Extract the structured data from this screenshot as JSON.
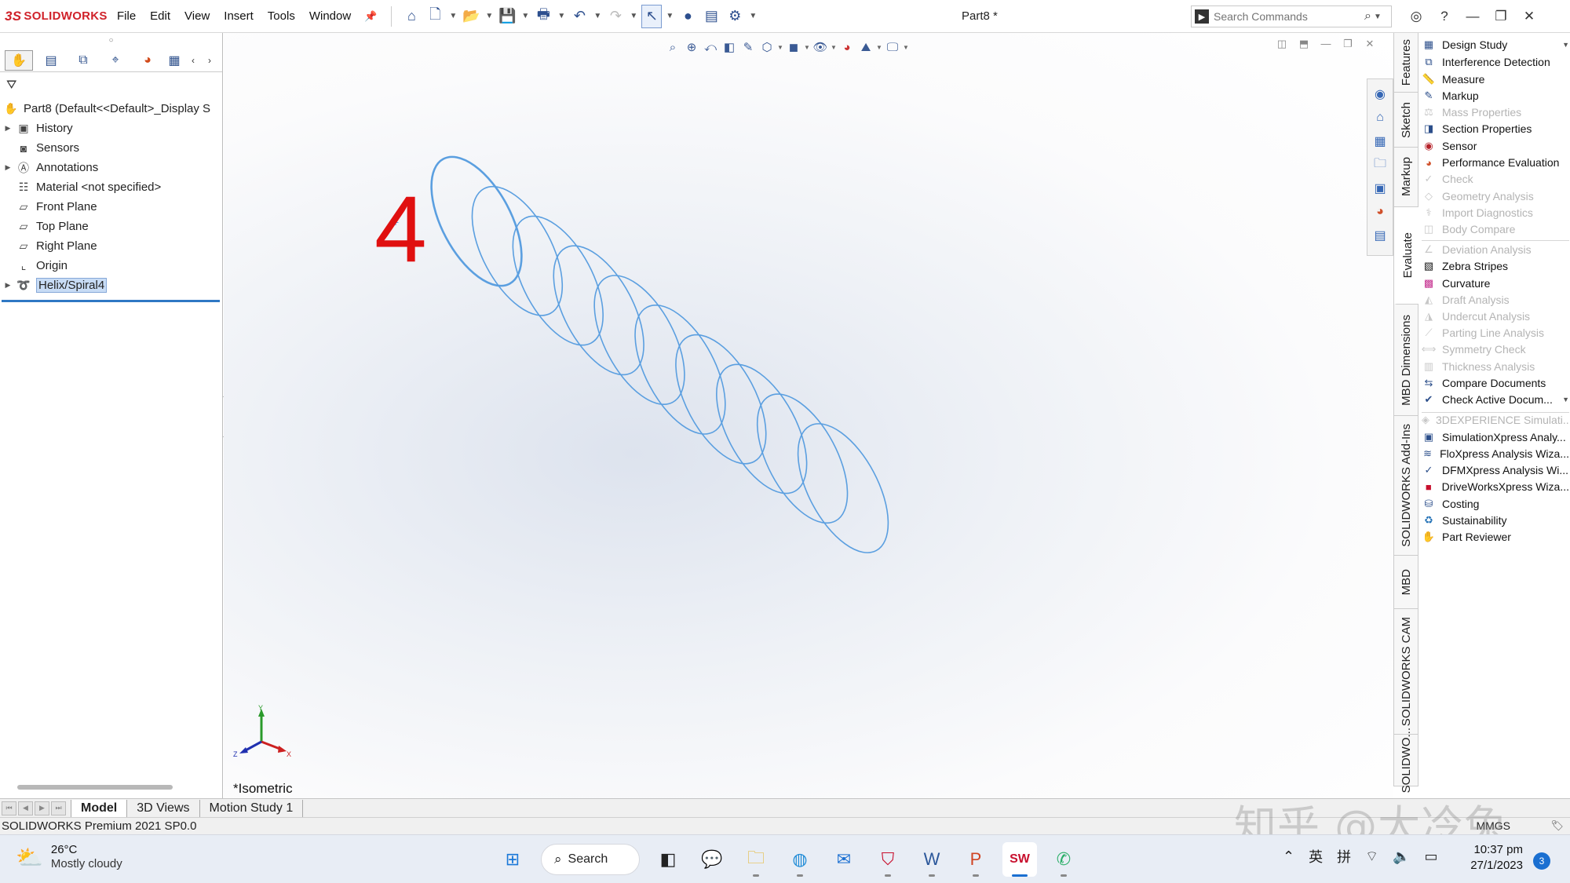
{
  "app": {
    "brand": "SOLIDWORKS",
    "brand_prefix": "3S",
    "doc_title": "Part8 *",
    "menus": [
      "File",
      "Edit",
      "View",
      "Insert",
      "Tools",
      "Window"
    ],
    "search_placeholder": "Search Commands"
  },
  "feature_tree": {
    "root": "Part8  (Default<<Default>_Display S",
    "items": [
      {
        "label": "History",
        "expandable": true,
        "icon": "history-icon"
      },
      {
        "label": "Sensors",
        "expandable": false,
        "icon": "sensors-icon"
      },
      {
        "label": "Annotations",
        "expandable": true,
        "icon": "annotations-icon"
      },
      {
        "label": "Material <not specified>",
        "expandable": false,
        "icon": "material-icon"
      },
      {
        "label": "Front Plane",
        "expandable": false,
        "icon": "plane-icon"
      },
      {
        "label": "Top Plane",
        "expandable": false,
        "icon": "plane-icon"
      },
      {
        "label": "Right Plane",
        "expandable": false,
        "icon": "plane-icon"
      },
      {
        "label": "Origin",
        "expandable": false,
        "icon": "origin-icon"
      },
      {
        "label": "Helix/Spiral4",
        "expandable": true,
        "icon": "helix-icon",
        "selected": true
      }
    ]
  },
  "graphics": {
    "annotation_number": "4",
    "view_name": "*Isometric",
    "triad": {
      "x": "X",
      "y": "Y",
      "z": "Z"
    },
    "helix_color": "#5b9fe0",
    "helix_turns": 10
  },
  "vertical_tabs": [
    "Features",
    "Sketch",
    "Markup",
    "Evaluate",
    "MBD Dimensions",
    "SOLIDWORKS Add-Ins",
    "MBD",
    "SOLIDWORKS CAM",
    "SOLIDWO..."
  ],
  "evaluate_commands": [
    {
      "label": "Design Study",
      "enabled": true,
      "icon": "design-study-icon",
      "dropdown": true
    },
    {
      "label": "Interference Detection",
      "enabled": true,
      "icon": "interference-icon"
    },
    {
      "label": "Measure",
      "enabled": true,
      "icon": "measure-icon"
    },
    {
      "label": "Markup",
      "enabled": true,
      "icon": "markup-icon"
    },
    {
      "label": "Mass Properties",
      "enabled": false,
      "icon": "mass-properties-icon"
    },
    {
      "label": "Section Properties",
      "enabled": true,
      "icon": "section-properties-icon"
    },
    {
      "label": "Sensor",
      "enabled": true,
      "icon": "sensor-icon"
    },
    {
      "label": "Performance Evaluation",
      "enabled": true,
      "icon": "performance-icon"
    },
    {
      "label": "Check",
      "enabled": false,
      "icon": "check-icon"
    },
    {
      "label": "Geometry Analysis",
      "enabled": false,
      "icon": "geometry-analysis-icon"
    },
    {
      "label": "Import Diagnostics",
      "enabled": false,
      "icon": "import-diagnostics-icon"
    },
    {
      "label": "Body Compare",
      "enabled": false,
      "icon": "body-compare-icon"
    },
    {
      "label": "Deviation Analysis",
      "enabled": false,
      "icon": "deviation-icon"
    },
    {
      "label": "Zebra Stripes",
      "enabled": true,
      "icon": "zebra-icon"
    },
    {
      "label": "Curvature",
      "enabled": true,
      "icon": "curvature-icon"
    },
    {
      "label": "Draft Analysis",
      "enabled": false,
      "icon": "draft-analysis-icon"
    },
    {
      "label": "Undercut Analysis",
      "enabled": false,
      "icon": "undercut-icon"
    },
    {
      "label": "Parting Line Analysis",
      "enabled": false,
      "icon": "parting-line-icon"
    },
    {
      "label": "Symmetry Check",
      "enabled": false,
      "icon": "symmetry-icon"
    },
    {
      "label": "Thickness Analysis",
      "enabled": false,
      "icon": "thickness-icon"
    },
    {
      "label": "Compare Documents",
      "enabled": true,
      "icon": "compare-icon"
    },
    {
      "label": "Check Active Docum...",
      "enabled": true,
      "icon": "check-active-icon",
      "dropdown": true
    },
    {
      "label": "3DEXPERIENCE Simulati...",
      "enabled": false,
      "icon": "3dx-icon"
    },
    {
      "label": "SimulationXpress Analy...",
      "enabled": true,
      "icon": "simxpress-icon"
    },
    {
      "label": "FloXpress Analysis Wiza...",
      "enabled": true,
      "icon": "floxpress-icon"
    },
    {
      "label": "DFMXpress Analysis Wi...",
      "enabled": true,
      "icon": "dfmxpress-icon"
    },
    {
      "label": "DriveWorksXpress Wiza...",
      "enabled": true,
      "icon": "driveworks-icon"
    },
    {
      "label": "Costing",
      "enabled": true,
      "icon": "costing-icon"
    },
    {
      "label": "Sustainability",
      "enabled": true,
      "icon": "sustainability-icon"
    },
    {
      "label": "Part Reviewer",
      "enabled": true,
      "icon": "part-reviewer-icon"
    }
  ],
  "bottom_tabs": [
    "Model",
    "3D Views",
    "Motion Study 1"
  ],
  "status": {
    "text": "SOLIDWORKS Premium 2021 SP0.0",
    "units": "MMGS"
  },
  "watermark": "知乎 @大冷兔",
  "taskbar": {
    "weather_temp": "26°C",
    "weather_cond": "Mostly cloudy",
    "search_label": "Search",
    "time": "10:37 pm",
    "date": "27/1/2023",
    "notifications": "3",
    "ime_lang": "英",
    "ime_mode": "拼"
  }
}
